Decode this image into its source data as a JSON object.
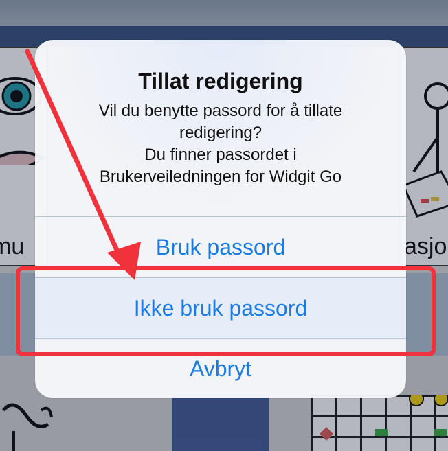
{
  "background": {
    "left_label": "mu",
    "right_label": "asjo"
  },
  "dialog": {
    "title": "Tillat redigering",
    "message": "Vil du benytte passord for å tillate\nredigering?\nDu finner passordet i\nBrukerveiledningen for Widgit Go",
    "buttons": {
      "use_password": "Bruk passord",
      "no_password": "Ikke bruk passord",
      "cancel": "Avbryt"
    }
  },
  "annotation": {
    "highlight_color": "#f0323c",
    "arrow_color": "#f0323c"
  }
}
